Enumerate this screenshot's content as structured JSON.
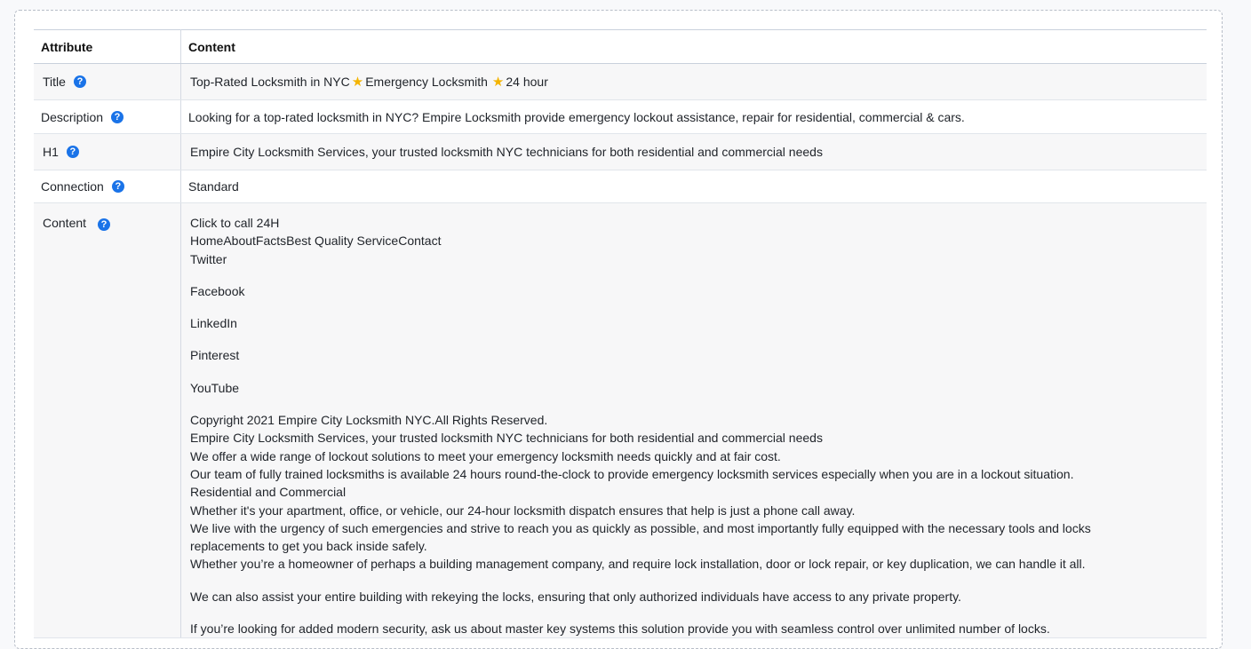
{
  "table": {
    "header": {
      "attribute": "Attribute",
      "content": "Content"
    },
    "title": {
      "label": "Title",
      "part1": "Top-Rated Locksmith in NYC",
      "part2": "Emergency Locksmith",
      "part3": "24 hour",
      "star_icon": "star-icon"
    },
    "description": {
      "label": "Description",
      "value": "Looking for a top-rated locksmith in NYC? Empire Locksmith provide emergency lockout assistance, repair for residential, commercial & cars."
    },
    "h1": {
      "label": "H1",
      "value": "Empire City Locksmith Services, your trusted locksmith NYC technicians for both residential and commercial needs"
    },
    "connection": {
      "label": "Connection",
      "value": "Standard"
    },
    "content": {
      "label": "Content",
      "lines": [
        "Click to call 24H",
        "HomeAboutFactsBest Quality ServiceContact",
        "Twitter",
        "Facebook",
        "LinkedIn",
        "Pinterest",
        "YouTube",
        "Copyright 2021 Empire City Locksmith NYC.All Rights Reserved.",
        "Empire City Locksmith Services, your trusted locksmith NYC technicians for both residential and commercial needs",
        "We offer a wide range of lockout solutions to meet your emergency locksmith needs quickly and at fair cost.",
        "Our team of fully trained locksmiths is available 24 hours round-the-clock to provide emergency locksmith services especially when you are in a lockout situation.",
        "Residential and Commercial",
        "Whether it's your apartment, office, or vehicle, our 24-hour locksmith dispatch ensures that help is just a phone call away.",
        "We live with the urgency of such emergencies and strive to reach you as quickly as possible, and most importantly fully equipped with the necessary tools and locks replacements to get you back inside safely.",
        "Whether you’re a homeowner of perhaps a building management company, and require lock installation, door or lock repair, or key duplication, we can handle it all.",
        "We can also assist your entire building with rekeying the locks, ensuring that only authorized individuals have access to any private property.",
        "If you’re looking for added modern security, ask us about master key systems this solution provide you with seamless control over unlimited number of locks."
      ]
    },
    "help_icon": "question-circle-icon"
  }
}
